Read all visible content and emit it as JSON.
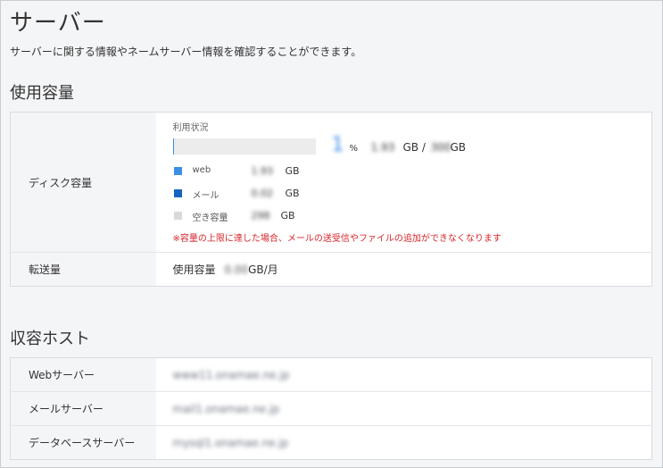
{
  "page": {
    "title": "サーバー",
    "description": "サーバーに関する情報やネームサーバー情報を確認することができます。"
  },
  "usage_section": {
    "title": "使用容量",
    "disk": {
      "label": "ディスク容量",
      "usage_caption": "利用状況",
      "percent": 1,
      "percent_text": "1",
      "percent_sign": "%",
      "used_value": "1.93",
      "gb_sep": "GB /",
      "total_value": "300",
      "gb_unit": "GB",
      "legend": [
        {
          "name": "web",
          "value": "1.93",
          "unit": "GB",
          "color": "#3c8ee6"
        },
        {
          "name": "メール",
          "value": "0.02",
          "unit": "GB",
          "color": "#1565c0"
        },
        {
          "name": "空き容量",
          "value": "298",
          "unit": "GB",
          "color": "#d9d9d9"
        }
      ],
      "warning": "※容量の上限に達した場合、メールの送受信やファイルの追加ができなくなります"
    },
    "transfer": {
      "label": "転送量",
      "value_label": "使用容量",
      "value": "0.00",
      "unit": "GB/月"
    }
  },
  "host_section": {
    "title": "収容ホスト",
    "rows": [
      {
        "label": "Webサーバー",
        "value": "www11.onamae.ne.jp"
      },
      {
        "label": "メールサーバー",
        "value": "mail1.onamae.ne.jp"
      },
      {
        "label": "データベースサーバー",
        "value": "mysql1.onamae.ne.jp"
      }
    ]
  }
}
